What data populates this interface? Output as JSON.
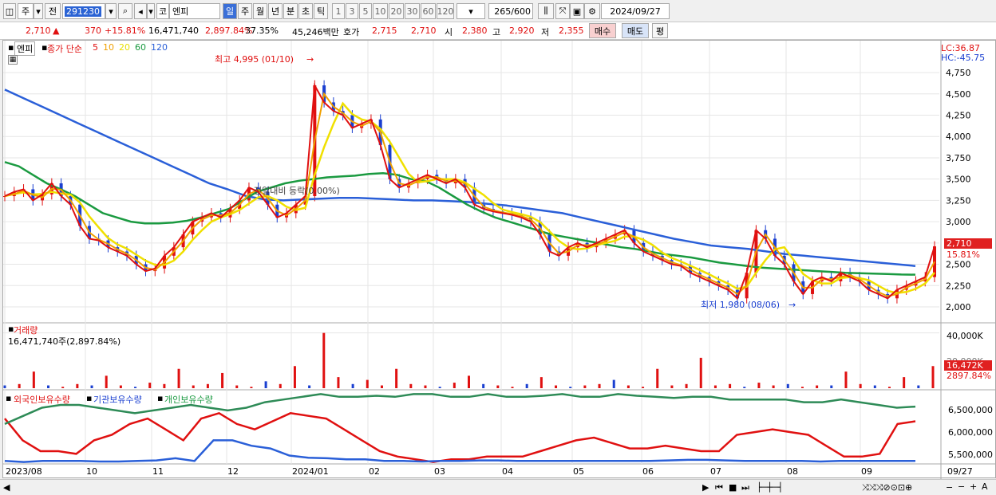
{
  "toolbar": {
    "period_type": "주",
    "jeon_label": "전",
    "stock_code": "291230",
    "market_label": "코",
    "stock_name": "엔피",
    "intervals": [
      "일",
      "주",
      "월",
      "년",
      "분",
      "초",
      "틱"
    ],
    "active_interval": "일",
    "numbers": [
      "1",
      "3",
      "5",
      "10",
      "20",
      "30",
      "60",
      "120"
    ],
    "count": "265",
    "count_total": "/600",
    "date": "2024/09/27"
  },
  "info": {
    "price": "2,710",
    "change_arrow": "▲",
    "change": "370",
    "change_pct": "+15.81%",
    "volume": "16,471,740",
    "volume_pct": "2,897.84%",
    "turnover": "37.35%",
    "amount": "45,246백만",
    "hoga_label": "호가",
    "hoga_ask": "2,715",
    "hoga_bid": "2,710",
    "open_label": "시",
    "open": "2,380",
    "high_label": "고",
    "high": "2,920",
    "low_label": "저",
    "low": "2,355",
    "buy": "매수",
    "sell": "매도",
    "eval": "평"
  },
  "chart_header": {
    "name": "엔피",
    "ma_label": "종가 단순",
    "ma_periods": [
      {
        "p": "5",
        "color": "#e01010"
      },
      {
        "p": "10",
        "color": "#f0a000"
      },
      {
        "p": "20",
        "color": "#e8e000"
      },
      {
        "p": "60",
        "color": "#1a9a40"
      },
      {
        "p": "120",
        "color": "#2a5fd8"
      }
    ],
    "lc": "LC:36.87",
    "hc": "HC:-45.75",
    "high_note": "최고 4,995 (01/10)",
    "low_note": "최저 1,980 (08/06)",
    "mid_note": "전일대비 등락(0.00%)",
    "last_price_tag": "2,710",
    "last_pct_tag": "15.81%"
  },
  "volume_panel": {
    "title": "거래량",
    "value": "16,471,740주(2,897.84%)",
    "ticks": [
      "40,000K",
      "20,000K"
    ],
    "tag_value": "16,472K",
    "tag_pct": "2897.84%"
  },
  "holding_panel": {
    "labels": [
      "외국인보유수량",
      "기관보유수량",
      "개인보유수량"
    ],
    "colors": [
      "#e01010",
      "#2a5fd8",
      "#1a9a40"
    ],
    "ticks": [
      "6,500,000",
      "6,000,000",
      "5,500,000"
    ]
  },
  "x_axis": [
    "2023/08",
    "10",
    "11",
    "12",
    "2024/01",
    "02",
    "03",
    "04",
    "05",
    "06",
    "07",
    "08",
    "09",
    "09/27"
  ],
  "chart_data": {
    "type": "line",
    "x_ticks": [
      "2023/08",
      "10",
      "11",
      "12",
      "2024/01",
      "02",
      "03",
      "04",
      "05",
      "06",
      "07",
      "08",
      "09"
    ],
    "y_ticks": [
      "4,750",
      "4,500",
      "4,250",
      "4,000",
      "3,750",
      "3,500",
      "3,250",
      "3,000",
      "2,750",
      "2,500",
      "2,250",
      "2,000"
    ],
    "ylim": [
      1850,
      5050
    ],
    "close": [
      3300,
      3350,
      3380,
      3250,
      3320,
      3450,
      3300,
      3200,
      2950,
      2800,
      2780,
      2700,
      2650,
      2600,
      2500,
      2420,
      2450,
      2600,
      2700,
      2850,
      3000,
      3050,
      3100,
      3050,
      3150,
      3250,
      3400,
      3350,
      3200,
      3050,
      3100,
      3200,
      3300,
      4600,
      4400,
      4300,
      4250,
      4100,
      4150,
      4200,
      3900,
      3500,
      3400,
      3450,
      3500,
      3550,
      3500,
      3450,
      3500,
      3400,
      3200,
      3150,
      3120,
      3100,
      3080,
      3050,
      3000,
      2850,
      2650,
      2600,
      2700,
      2750,
      2700,
      2750,
      2800,
      2850,
      2900,
      2750,
      2650,
      2600,
      2550,
      2500,
      2480,
      2400,
      2350,
      2300,
      2250,
      2200,
      2100,
      2400,
      2900,
      2800,
      2600,
      2500,
      2300,
      2150,
      2300,
      2350,
      2300,
      2400,
      2350,
      2300,
      2200,
      2150,
      2100,
      2200,
      2250,
      2300,
      2350,
      2710
    ],
    "ma60": [
      3700,
      3650,
      3550,
      3450,
      3380,
      3300,
      3200,
      3100,
      3050,
      3000,
      2980,
      2980,
      2990,
      3010,
      3050,
      3100,
      3150,
      3250,
      3350,
      3400,
      3450,
      3480,
      3500,
      3520,
      3530,
      3540,
      3560,
      3570,
      3550,
      3500,
      3480,
      3400,
      3300,
      3200,
      3120,
      3050,
      3000,
      2950,
      2900,
      2850,
      2820,
      2790,
      2760,
      2730,
      2700,
      2680,
      2650,
      2620,
      2600,
      2580,
      2550,
      2520,
      2500,
      2480,
      2460,
      2450,
      2440,
      2430,
      2420,
      2410,
      2400,
      2395,
      2390,
      2385,
      2380,
      2378
    ],
    "ma120": [
      4550,
      4450,
      4350,
      4250,
      4150,
      4050,
      3950,
      3850,
      3750,
      3650,
      3550,
      3450,
      3380,
      3300,
      3260,
      3250,
      3260,
      3270,
      3280,
      3280,
      3270,
      3260,
      3250,
      3250,
      3240,
      3230,
      3210,
      3190,
      3160,
      3130,
      3100,
      3050,
      3000,
      2950,
      2900,
      2850,
      2800,
      2760,
      2720,
      2700,
      2680,
      2650,
      2620,
      2600,
      2580,
      2560,
      2540,
      2520,
      2500,
      2480
    ],
    "volume": [
      2,
      3,
      12,
      2,
      1,
      3,
      2,
      9,
      2,
      1,
      4,
      3,
      14,
      2,
      3,
      11,
      2,
      1,
      5,
      3,
      16,
      2,
      40,
      8,
      3,
      6,
      2,
      14,
      3,
      2,
      1,
      4,
      9,
      3,
      2,
      1,
      3,
      8,
      2,
      1,
      2,
      3,
      6,
      2,
      1,
      14,
      2,
      3,
      22,
      2,
      3,
      1,
      4,
      2,
      3,
      1,
      2,
      2,
      12,
      3,
      2,
      1,
      8,
      2,
      16
    ],
    "foreign": [
      6200,
      5800,
      5600,
      5600,
      5550,
      5800,
      5900,
      6100,
      6200,
      6000,
      5800,
      6200,
      6300,
      6100,
      6000,
      6150,
      6300,
      6250,
      6200,
      6000,
      5800,
      5600,
      5500,
      5450,
      5400,
      5450,
      5450,
      5500,
      5500,
      5500,
      5600,
      5700,
      5800,
      5850,
      5750,
      5650,
      5650,
      5700,
      5650,
      5600,
      5600,
      5900,
      5950,
      6000,
      5950,
      5900,
      5700,
      5500,
      5500,
      5550,
      6100,
      6150
    ],
    "institution": [
      5420,
      5400,
      5420,
      5420,
      5420,
      5410,
      5410,
      5420,
      5430,
      5470,
      5420,
      5800,
      5800,
      5700,
      5650,
      5520,
      5480,
      5470,
      5450,
      5450,
      5420,
      5420,
      5410,
      5420,
      5420,
      5430,
      5430,
      5420,
      5420,
      5420,
      5420,
      5420,
      5420,
      5420,
      5420,
      5430,
      5440,
      5440,
      5430,
      5420,
      5420,
      5420,
      5420,
      5410,
      5420,
      5420,
      5420,
      5420,
      5420
    ],
    "individual": [
      6100,
      6250,
      6400,
      6450,
      6450,
      6400,
      6350,
      6300,
      6350,
      6400,
      6450,
      6400,
      6350,
      6400,
      6500,
      6550,
      6600,
      6650,
      6600,
      6600,
      6620,
      6600,
      6650,
      6650,
      6600,
      6600,
      6650,
      6600,
      6600,
      6620,
      6650,
      6600,
      6600,
      6650,
      6620,
      6600,
      6580,
      6600,
      6600,
      6550,
      6550,
      6550,
      6550,
      6500,
      6500,
      6550,
      6500,
      6450,
      6400,
      6420
    ]
  }
}
